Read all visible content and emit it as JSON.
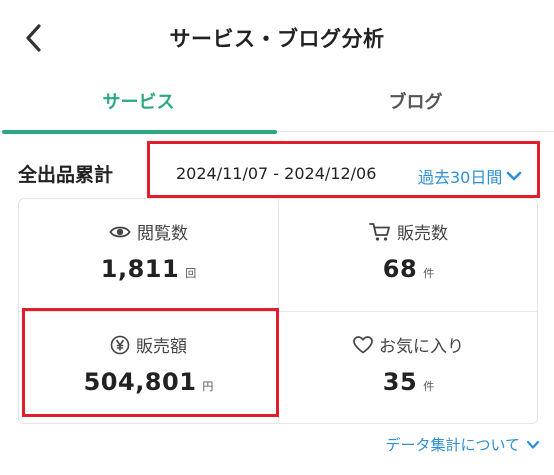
{
  "header": {
    "title": "サービス・ブログ分析"
  },
  "tabs": [
    {
      "label": "サービス"
    },
    {
      "label": "ブログ"
    }
  ],
  "section": {
    "title": "全出品累計",
    "date_range": "2024/11/07 - 2024/12/06",
    "period_label": "過去30日間"
  },
  "stats": {
    "views": {
      "label": "閲覧数",
      "value": "1,811",
      "unit": "回",
      "icon": "eye-icon"
    },
    "sales_count": {
      "label": "販売数",
      "value": "68",
      "unit": "件",
      "icon": "cart-icon"
    },
    "sales_amount": {
      "label": "販売額",
      "value": "504,801",
      "unit": "円",
      "icon": "yen-icon"
    },
    "favorites": {
      "label": "お気に入り",
      "value": "35",
      "unit": "件",
      "icon": "heart-icon"
    }
  },
  "footer": {
    "link_label": "データ集計について"
  },
  "colors": {
    "accent": "#2aa886",
    "link": "#2d8fd6",
    "highlight": "#e01e2c"
  }
}
